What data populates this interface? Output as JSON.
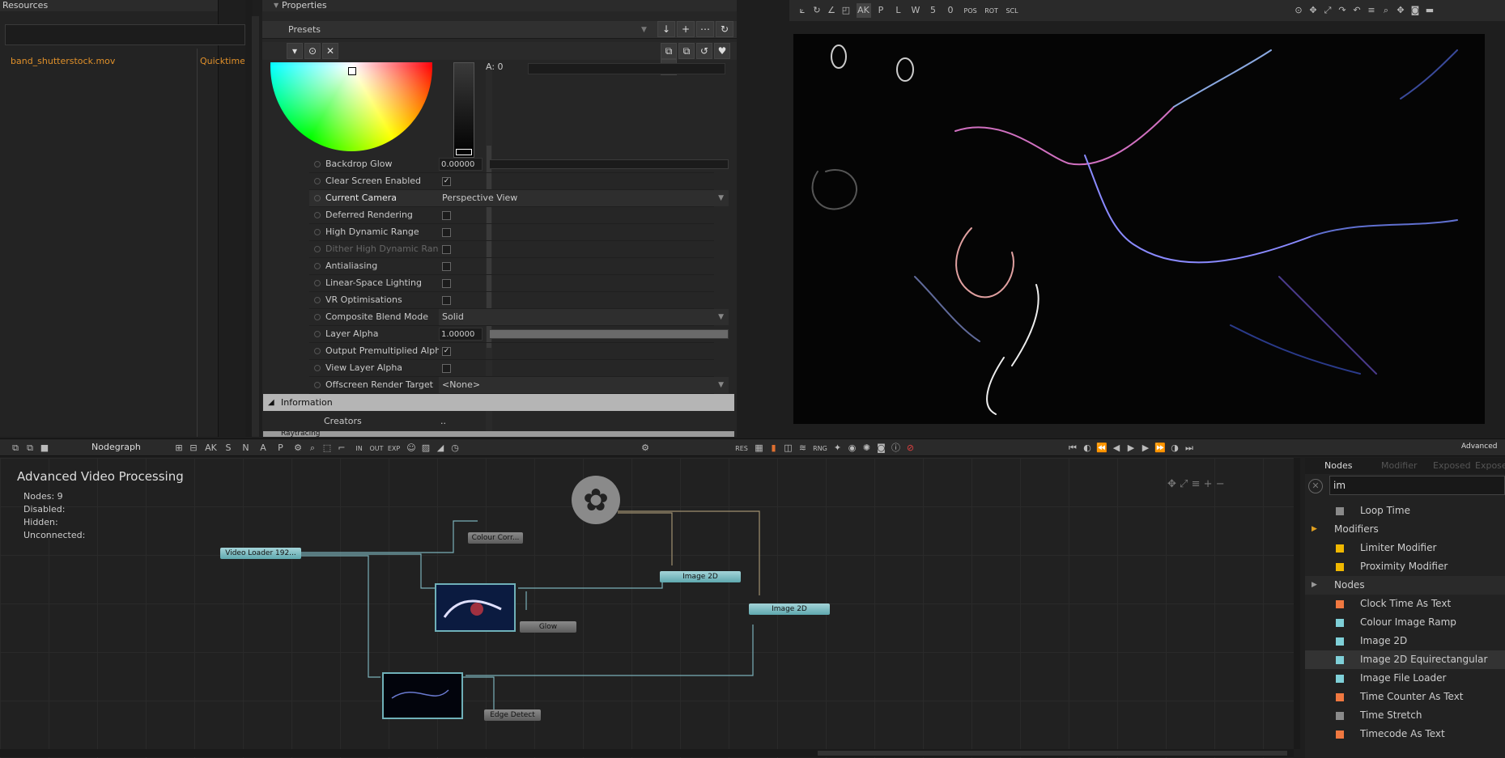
{
  "resources": {
    "title": "Resources",
    "file": "band_shutterstock.mov",
    "type": "Quicktime"
  },
  "properties": {
    "title": "Properties",
    "presets": "Presets",
    "alpha_label": "A: 0",
    "rows": [
      {
        "label": "Backdrop Glow",
        "kind": "num",
        "value": "0.00000"
      },
      {
        "label": "Clear Screen Enabled",
        "kind": "check",
        "checked": true
      },
      {
        "label": "Current Camera",
        "kind": "dropdown",
        "value": "Perspective View"
      },
      {
        "label": "Deferred Rendering",
        "kind": "check",
        "checked": false
      },
      {
        "label": "High Dynamic Range",
        "kind": "check",
        "checked": false
      },
      {
        "label": "Dither High Dynamic Rang",
        "kind": "check",
        "checked": false,
        "disabled": true
      },
      {
        "label": "Antialiasing",
        "kind": "check",
        "checked": false
      },
      {
        "label": "Linear-Space Lighting",
        "kind": "check",
        "checked": false
      },
      {
        "label": "VR Optimisations",
        "kind": "check",
        "checked": false
      },
      {
        "label": "Composite Blend Mode",
        "kind": "dropdown",
        "value": "Solid"
      },
      {
        "label": "Layer Alpha",
        "kind": "num",
        "value": "1.00000"
      },
      {
        "label": "Output Premultiplied Alph",
        "kind": "check",
        "checked": true
      },
      {
        "label": "View Layer Alpha",
        "kind": "check",
        "checked": false
      },
      {
        "label": "Offscreen Render Target",
        "kind": "dropdown",
        "value": "<None>"
      }
    ],
    "section": "Information",
    "creators_label": "Creators",
    "creators_value": "..",
    "next_section": "Raytracing"
  },
  "nodegraph": {
    "tab": "Nodegraph",
    "title": "Advanced  Video  Processing",
    "stats": {
      "nodes": "Nodes:  9",
      "disabled": "Disabled:",
      "hidden": "Hidden:",
      "unconnected": "Unconnected:"
    },
    "nodes": {
      "video_loader": "Video  Loader  192...",
      "colour_corr": "Colour  Corr...",
      "glow": "Glow",
      "image2d_a": "Image  2D",
      "image2d_b": "Image  2D",
      "edge": "Edge  Detect"
    },
    "toolbar_letters": [
      "AK",
      "S",
      "N",
      "A",
      "P"
    ],
    "toolbar_text": [
      "IN",
      "OUT",
      "EXP"
    ],
    "midbar_text": [
      "RES",
      "RNG",
      "Advanced"
    ]
  },
  "nodelist": {
    "tabs": [
      "Nodes",
      "Modifier",
      "Exposed",
      "Exposed"
    ],
    "search": "im",
    "items": [
      {
        "label": "Loop Time",
        "color": "#8a8a8a",
        "indent": true
      },
      {
        "label": "Modifiers",
        "group": true,
        "open": true
      },
      {
        "label": "Limiter Modifier",
        "color": "#f0b800",
        "indent": true
      },
      {
        "label": "Proximity Modifier",
        "color": "#f0b800",
        "indent": true
      },
      {
        "label": "Nodes",
        "group": true,
        "open": false
      },
      {
        "label": "Clock Time As Text",
        "color": "#f07840",
        "indent": true
      },
      {
        "label": "Colour Image Ramp",
        "color": "#7fd0d8",
        "indent": true
      },
      {
        "label": "Image 2D",
        "color": "#7fd0d8",
        "indent": true
      },
      {
        "label": "Image 2D Equirectangular",
        "color": "#7fd0d8",
        "indent": true,
        "selected": true
      },
      {
        "label": "Image File Loader",
        "color": "#7fd0d8",
        "indent": true
      },
      {
        "label": "Time Counter As Text",
        "color": "#f07840",
        "indent": true
      },
      {
        "label": "Time Stretch",
        "color": "#8a8a8a",
        "indent": true
      },
      {
        "label": "Timecode As Text",
        "color": "#f07840",
        "indent": true
      }
    ]
  },
  "viewer_toolbar": {
    "buttons": [
      "AK",
      "P",
      "L",
      "W",
      "5",
      "0"
    ],
    "locks": [
      "POS",
      "ROT",
      "SCL"
    ]
  }
}
